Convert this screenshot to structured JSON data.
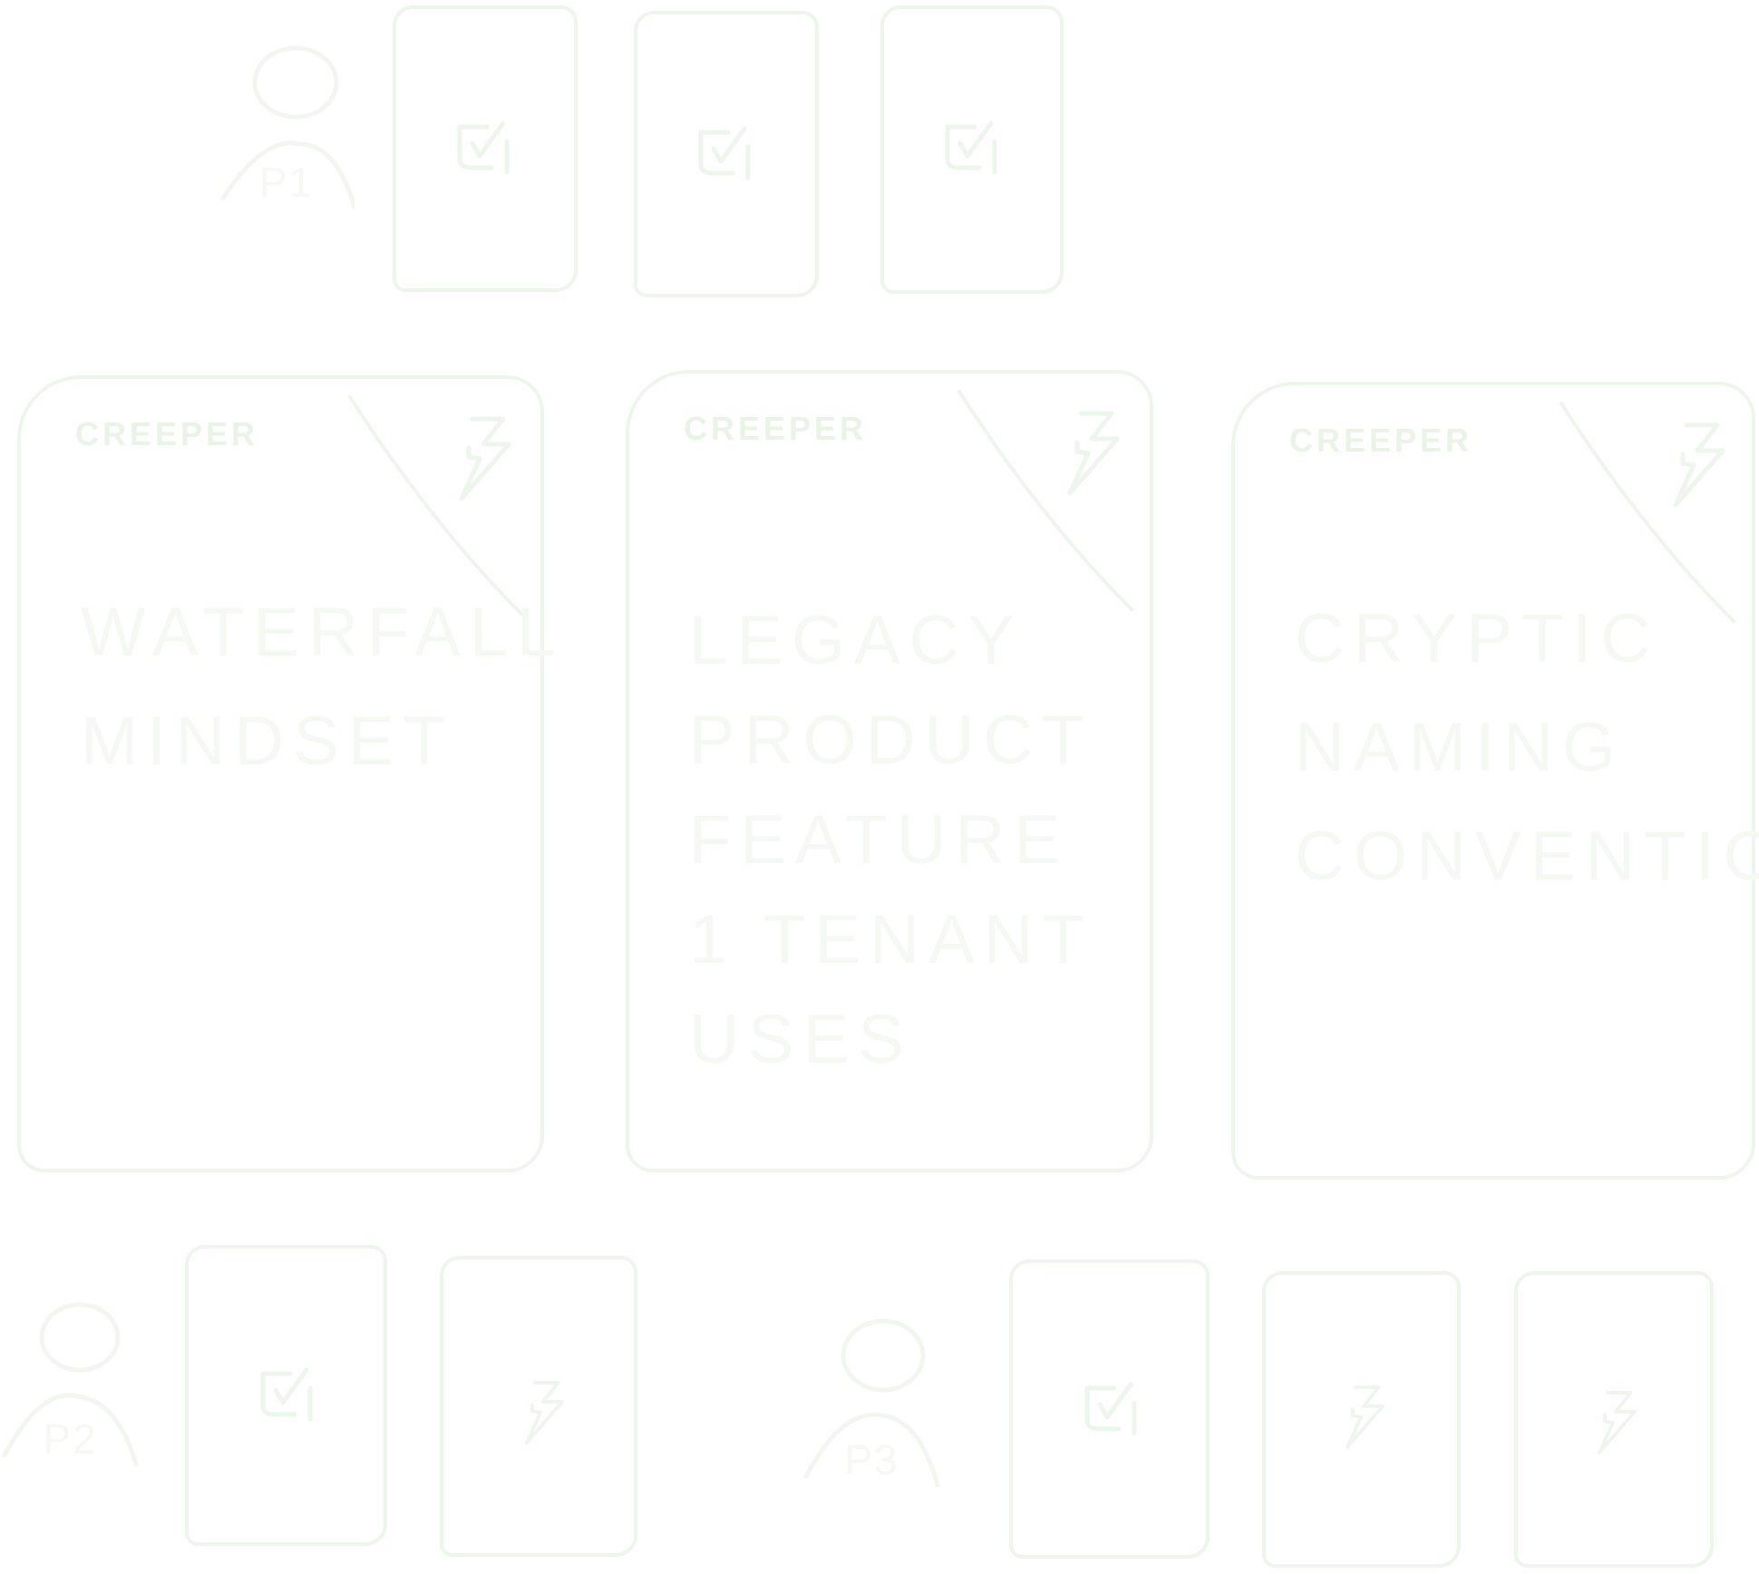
{
  "colors": {
    "stroke": "#eef5ec",
    "faint_text": "#f6f8f4"
  },
  "personas": [
    {
      "label": "P1"
    },
    {
      "label": "P2"
    },
    {
      "label": "P3"
    }
  ],
  "small_cards": {
    "p1": [
      {
        "icon": "checkbox-check-icon"
      },
      {
        "icon": "checkbox-check-icon"
      },
      {
        "icon": "checkbox-check-icon"
      }
    ],
    "p2": [
      {
        "icon": "checkbox-check-icon"
      },
      {
        "icon": "lightning-icon"
      }
    ],
    "p3": [
      {
        "icon": "checkbox-check-icon"
      },
      {
        "icon": "lightning-icon"
      },
      {
        "icon": "lightning-icon"
      }
    ]
  },
  "big_cards": [
    {
      "kind": "CREEPER",
      "icon": "lightning-icon",
      "text": "Waterfall mindset"
    },
    {
      "kind": "CREEPER",
      "icon": "lightning-icon",
      "text": "Legacy product feature 1 tenant uses"
    },
    {
      "kind": "CREEPER",
      "icon": "lightning-icon",
      "text": "Cryptic naming convention"
    }
  ]
}
